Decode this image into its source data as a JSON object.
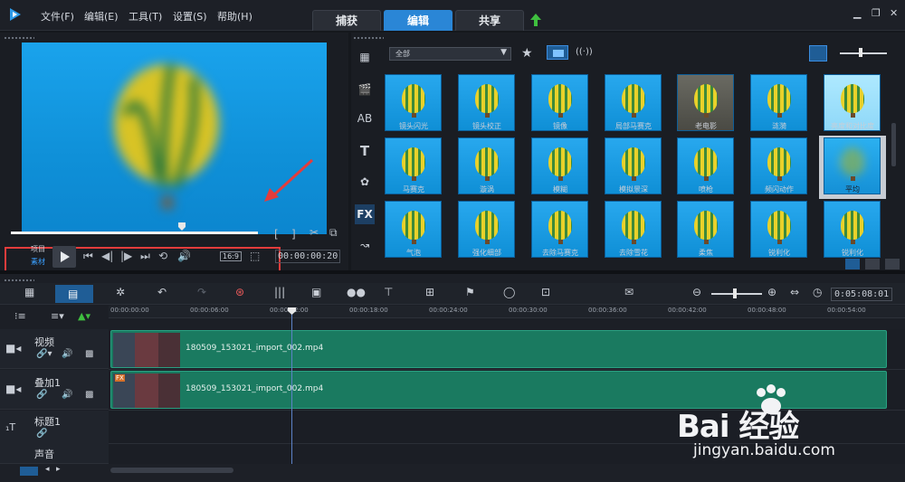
{
  "menus": [
    "文件(F)",
    "编辑(E)",
    "工具(T)",
    "设置(S)",
    "帮助(H)"
  ],
  "tabs": [
    "捕获",
    "编辑",
    "共享"
  ],
  "active_tab": "编辑",
  "preview": {
    "labels": [
      "项目",
      "素材"
    ],
    "aspect": "16:9",
    "timecode": "00:00:00:20"
  },
  "fx": {
    "category": "全部",
    "items": [
      "镜头闪光",
      "镜头校正",
      "镜像",
      "局部马赛克",
      "老电影",
      "涟漪",
      "亮度和对比度",
      "马赛克",
      "漩涡",
      "模糊",
      "模拟景深",
      "喷枪",
      "频闪动作",
      "平均",
      "气泡",
      "强化细部",
      "去除马赛克",
      "去除雪花",
      "柔焦",
      "锐利化",
      "锐利化"
    ],
    "selected_index": 13
  },
  "timeline": {
    "duration": "0:05:08:01",
    "ruler": [
      "00:00:00:00",
      "00:00:06:00",
      "00:00:12:00",
      "00:00:18:00",
      "00:00:24:00",
      "00:00:30:00",
      "00:00:36:00",
      "00:00:42:00",
      "00:00:48:00",
      "00:00:54:00"
    ],
    "tracks": [
      {
        "name": "视频",
        "clip": "180509_153021_import_002.mp4"
      },
      {
        "name": "叠加1",
        "clip": "180509_153021_import_002.mp4"
      },
      {
        "name": "标题1",
        "clip": ""
      },
      {
        "name": "声音",
        "clip": ""
      }
    ]
  },
  "watermark": {
    "brand": "Bai 经验",
    "url": "jingyan.baidu.com"
  },
  "colors": {
    "accent": "#2a86d6",
    "clip": "#1a7a60",
    "highlight_box": "#e43c3c"
  }
}
